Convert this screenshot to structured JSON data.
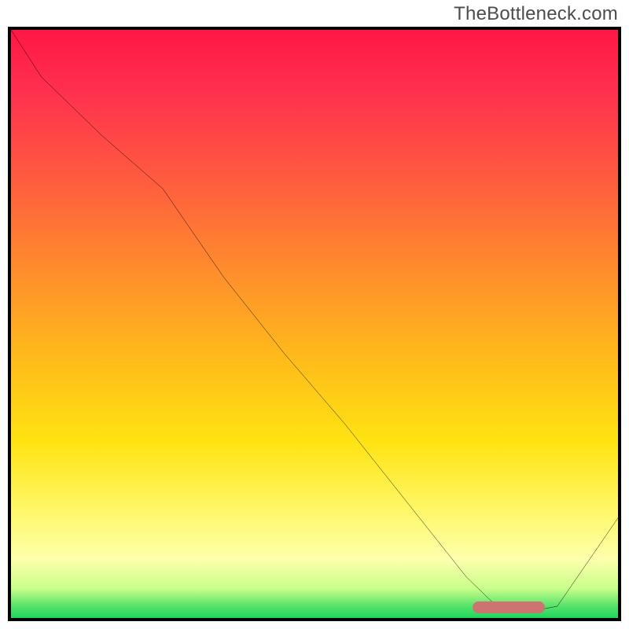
{
  "watermark": "TheBottleneck.com",
  "chart_data": {
    "type": "line",
    "title": "",
    "xlabel": "",
    "ylabel": "",
    "xlim": [
      0,
      100
    ],
    "ylim": [
      0,
      100
    ],
    "x": [
      0,
      5,
      15,
      25,
      35,
      45,
      55,
      65,
      75,
      80,
      85,
      90,
      100
    ],
    "values": [
      100,
      92,
      82,
      73,
      58,
      45,
      33,
      20,
      7,
      2,
      1,
      2,
      17
    ],
    "marker_range_x": [
      76,
      88
    ],
    "gradient_stops": [
      {
        "pos": 0,
        "color": "#ff1744"
      },
      {
        "pos": 25,
        "color": "#ff5a3f"
      },
      {
        "pos": 55,
        "color": "#ffb81b"
      },
      {
        "pos": 82,
        "color": "#fff86a"
      },
      {
        "pos": 95,
        "color": "#c9ff8a"
      },
      {
        "pos": 100,
        "color": "#1fd65e"
      }
    ]
  }
}
